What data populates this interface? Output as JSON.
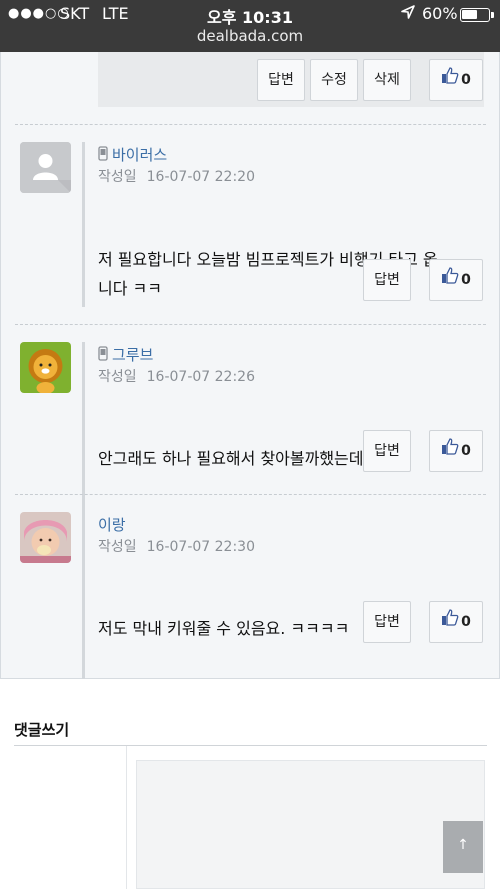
{
  "status_bar": {
    "signal": "●●●○○",
    "carrier": "SKT",
    "network": "LTE",
    "time": "오후 10:31",
    "location_icon": "location-arrow-icon",
    "battery_pct": "60%",
    "battery_level": 0.6,
    "url": "dealbada.com"
  },
  "top_actions": {
    "reply_label": "답변",
    "edit_label": "수정",
    "delete_label": "삭제",
    "like_count": "0"
  },
  "comments": [
    {
      "author": "바이러스",
      "mobile": true,
      "avatar": "default-user-icon",
      "meta_label": "작성일",
      "date": "16-07-07 22:20",
      "text_lines": [
        "저 필요합니다 오늘밤 빔프로젝트가 비행기 타고 옵",
        "니다 ㅋㅋ"
      ],
      "reply_label": "답변",
      "like_count": "0"
    },
    {
      "author": "그루브",
      "mobile": true,
      "avatar": "lion-character-avatar",
      "meta_label": "작성일",
      "date": "16-07-07 22:26",
      "text_lines": [
        "안그래도 하나 필요해서 찾아볼까했는데^^"
      ],
      "reply_label": "답변",
      "like_count": "0"
    },
    {
      "author": "이랑",
      "mobile": false,
      "avatar": "child-photo-avatar",
      "meta_label": "작성일",
      "date": "16-07-07 22:30",
      "text_lines": [
        "저도 막내 키워줄 수 있음요. ㅋㅋㅋㅋ"
      ],
      "reply_label": "답변",
      "like_count": "0"
    }
  ],
  "write": {
    "title": "댓글쓰기",
    "textarea_value": ""
  },
  "scroll_top": {
    "label": "↑"
  }
}
